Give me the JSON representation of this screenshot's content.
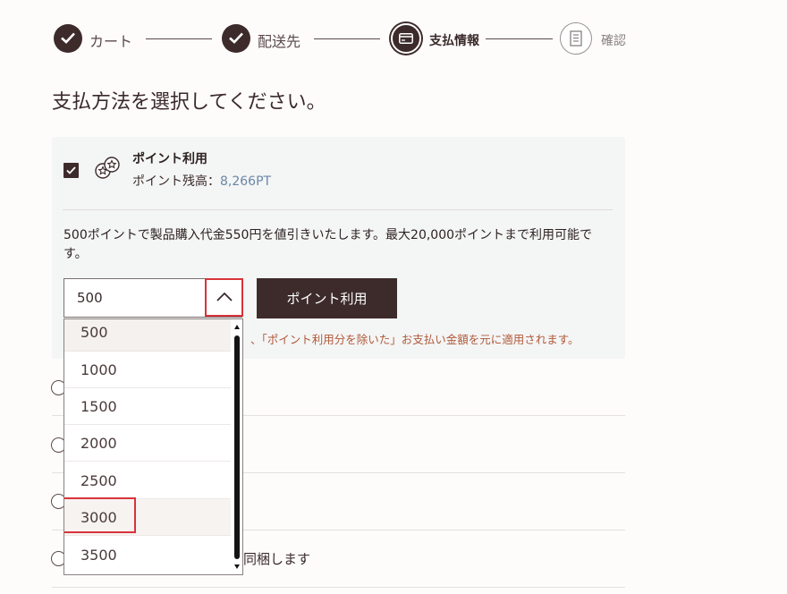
{
  "steps": [
    {
      "label": "カート",
      "state": "done"
    },
    {
      "label": "配送先",
      "state": "done"
    },
    {
      "label": "支払情報",
      "state": "current"
    },
    {
      "label": "確認",
      "state": "upcoming"
    }
  ],
  "heading": "支払方法を選択してください。",
  "points": {
    "title": "ポイント利用",
    "balance_label": "ポイント残高：",
    "balance_value": "8,266PT",
    "description": "500ポイントで製品購入代金550円を値引きいたします。最大20,000ポイントまで利用可能です。",
    "selected_value": "500",
    "apply_label": "ポイント利用",
    "note": "、「ポイント利用分を除いた」お支払い金額を元に適用されます。",
    "checked": true
  },
  "dropdown": {
    "options": [
      "500",
      "1000",
      "1500",
      "2000",
      "2500",
      "3000",
      "3500"
    ],
    "highlighted": "3000"
  },
  "payment_row_partial_text": "同梱します",
  "colors": {
    "brand": "#3d2b2b",
    "accent_link": "#6a86a8",
    "note_text": "#b05a3a",
    "highlight_outline": "#d9333a"
  }
}
